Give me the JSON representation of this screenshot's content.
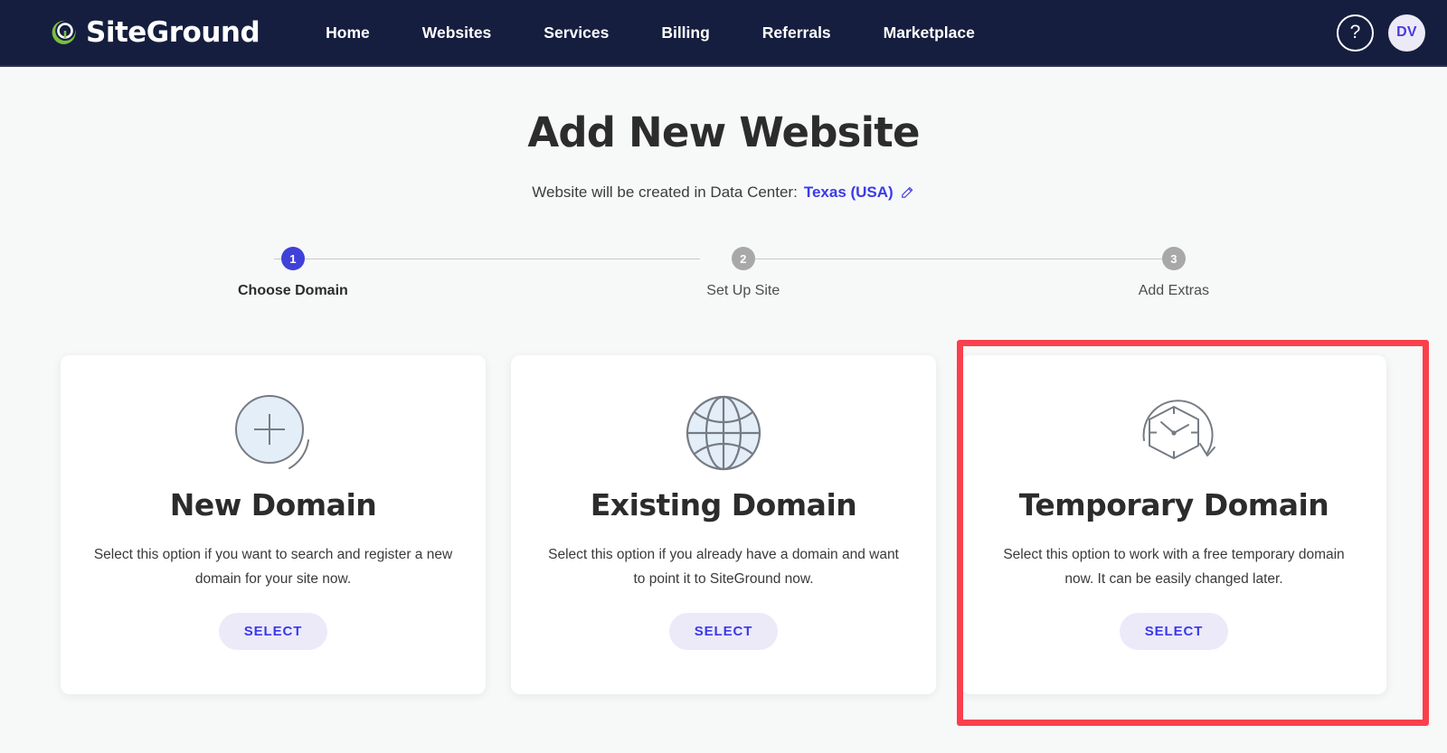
{
  "navbar": {
    "logo_text": "SiteGround",
    "logo_icon": "siteground-logo-icon",
    "links": [
      {
        "label": "Home"
      },
      {
        "label": "Websites"
      },
      {
        "label": "Services"
      },
      {
        "label": "Billing"
      },
      {
        "label": "Referrals"
      },
      {
        "label": "Marketplace"
      }
    ],
    "help_label": "?",
    "avatar_initials": "DV",
    "colors": {
      "background": "#151e3e",
      "logo_mark": "#79bf3f",
      "avatar_bg": "#eceaf7",
      "avatar_text": "#4a3ae0"
    }
  },
  "page": {
    "title": "Add New Website",
    "subtitle_prefix": "Website will be created in Data Center:",
    "data_center": "Texas (USA)",
    "edit_icon": "pencil-icon"
  },
  "stepper": {
    "steps": [
      {
        "number": "1",
        "label": "Choose Domain",
        "state": "active"
      },
      {
        "number": "2",
        "label": "Set Up Site",
        "state": "inactive"
      },
      {
        "number": "3",
        "label": "Add Extras",
        "state": "inactive"
      }
    ],
    "colors": {
      "active": "#3f41d8",
      "inactive": "#a8a8a8",
      "line": "#c9c9c9"
    }
  },
  "cards": [
    {
      "icon": "plus-circle-icon",
      "title": "New Domain",
      "description": "Select this option if you want to search and register a new domain for your site now.",
      "button_label": "SELECT",
      "highlighted": false
    },
    {
      "icon": "globe-icon",
      "title": "Existing Domain",
      "description": "Select this option if you already have a domain and want to point it to SiteGround now.",
      "button_label": "SELECT",
      "highlighted": false
    },
    {
      "icon": "temporary-clock-icon",
      "title": "Temporary Domain",
      "description": "Select this option to work with a free temporary domain now. It can be easily changed later.",
      "button_label": "SELECT",
      "highlighted": true
    }
  ],
  "highlight": {
    "color": "#fa404c",
    "target": "temporary-domain-card"
  }
}
